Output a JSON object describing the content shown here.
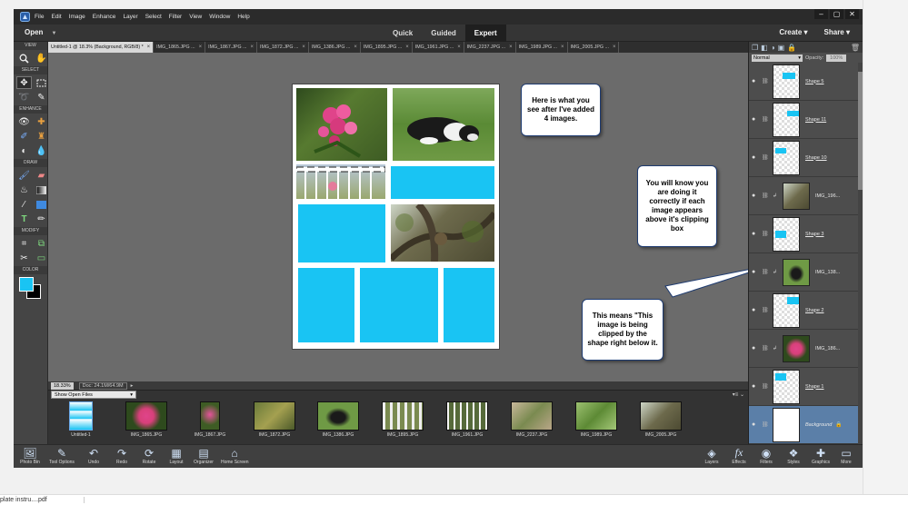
{
  "menubar": {
    "items": [
      "File",
      "Edit",
      "Image",
      "Enhance",
      "Layer",
      "Select",
      "Filter",
      "View",
      "Window",
      "Help"
    ],
    "window_buttons": [
      "–",
      "▢",
      "✕"
    ]
  },
  "modebar": {
    "open_label": "Open",
    "modes": [
      "Quick",
      "Guided",
      "Expert"
    ],
    "active_mode": "Expert",
    "create_label": "Create",
    "share_label": "Share"
  },
  "tools": {
    "view_label": "VIEW",
    "select_label": "SELECT",
    "enhance_label": "ENHANCE",
    "draw_label": "DRAW",
    "modify_label": "MODIFY",
    "color_label": "COLOR",
    "view": [
      "zoom-icon",
      "hand-icon"
    ],
    "select": [
      "move-icon",
      "marquee-icon",
      "lasso-icon",
      "quick-selection-icon"
    ],
    "enhance": [
      "eye-icon",
      "spot-heal-icon",
      "smart-brush-icon",
      "clone-stamp-icon",
      "sponge-icon",
      "blur-icon"
    ],
    "draw": [
      "brush-icon",
      "eraser-icon",
      "paint-bucket-icon",
      "gradient-icon",
      "eyedropper-icon",
      "shape-icon",
      "type-icon",
      "pencil-icon"
    ],
    "modify": [
      "crop-icon",
      "recompose-icon",
      "content-aware-move-icon",
      "straighten-icon"
    ],
    "foreground_color": "#19c4f3",
    "background_color": "#000000"
  },
  "tabs": [
    "Untitled-1 @ 18.3% (Background, RGB/8) *",
    "IMG_1865.JPG ...",
    "IMG_1867.JPG ...",
    "IMG_1872.JPG ...",
    "IMG_1386.JPG ...",
    "IMG_1895.JPG ...",
    "IMG_1961.JPG ...",
    "IMG_2237.JPG ...",
    "IMG_1989.JPG ...",
    "IMG_2005.JPG ..."
  ],
  "callouts": {
    "c1": "Here is what you see after I've added 4 images.",
    "c2": "You will know you are doing it correctly if each image appears above it's clipping box",
    "c3": "This means \"This image is being clipped by the shape right below it."
  },
  "status": {
    "zoom": "18.33%",
    "doc": "Doc: 24.1M/64.9M"
  },
  "photo_bin": {
    "dropdown": "Show Open Files",
    "thumbs": [
      "Untitled-1",
      "IMG_1865.JPG",
      "IMG_1867.JPG",
      "IMG_1872.JPG",
      "IMG_1386.JPG",
      "IMG_1895.JPG",
      "IMG_1961.JPG",
      "IMG_2237.JPG",
      "IMG_1989.JPG",
      "IMG_2005.JPG"
    ]
  },
  "bottom_bar": {
    "left": [
      "Photo Bin",
      "Tool Options",
      "Undo",
      "Redo",
      "Rotate",
      "Layout",
      "Organizer",
      "Home Screen"
    ],
    "right": [
      "Layers",
      "Effects",
      "Filters",
      "Styles",
      "Graphics",
      "More"
    ]
  },
  "layers_panel": {
    "blend_mode": "Normal",
    "opacity_label": "Opacity:",
    "opacity_value": "100%",
    "layers": [
      "Shape 5",
      "Shape 11",
      "Shape 10",
      "IMG_196...",
      "Shape 3",
      "IMG_138...",
      "Shape 2",
      "IMG_186...",
      "Shape 1",
      "Background"
    ]
  },
  "taskbar": {
    "file": "plate instru....pdf"
  }
}
